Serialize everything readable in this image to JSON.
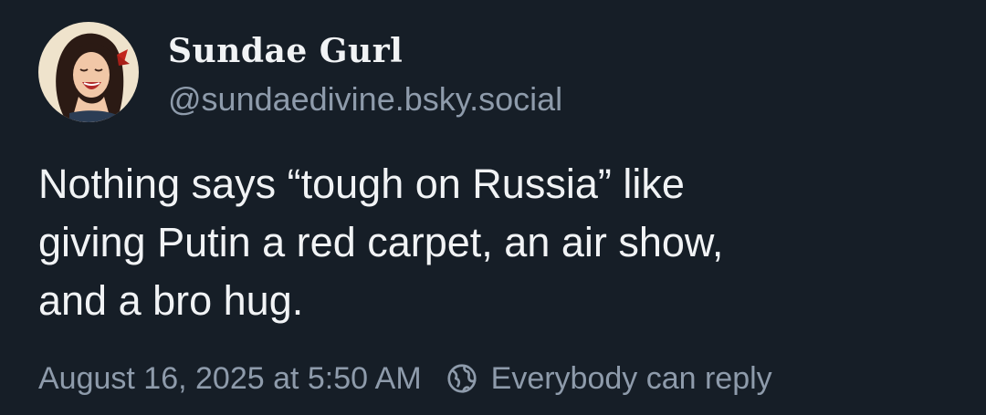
{
  "author": {
    "display_name": "Sundae Gurl",
    "handle": "@sundaedivine.bsky.social"
  },
  "post": {
    "text_lines": [
      "Nothing says “tough on Russia” like",
      "giving Putin a red carpet, an air show,",
      "and a bro hug."
    ]
  },
  "meta": {
    "timestamp": "August 16, 2025 at 5:50 AM",
    "reply_setting": "Everybody can reply",
    "reply_icon": "globe-icon"
  },
  "colors": {
    "background": "#161e27",
    "primary_text": "#f1f3f5",
    "secondary_text": "#8e9bab"
  }
}
